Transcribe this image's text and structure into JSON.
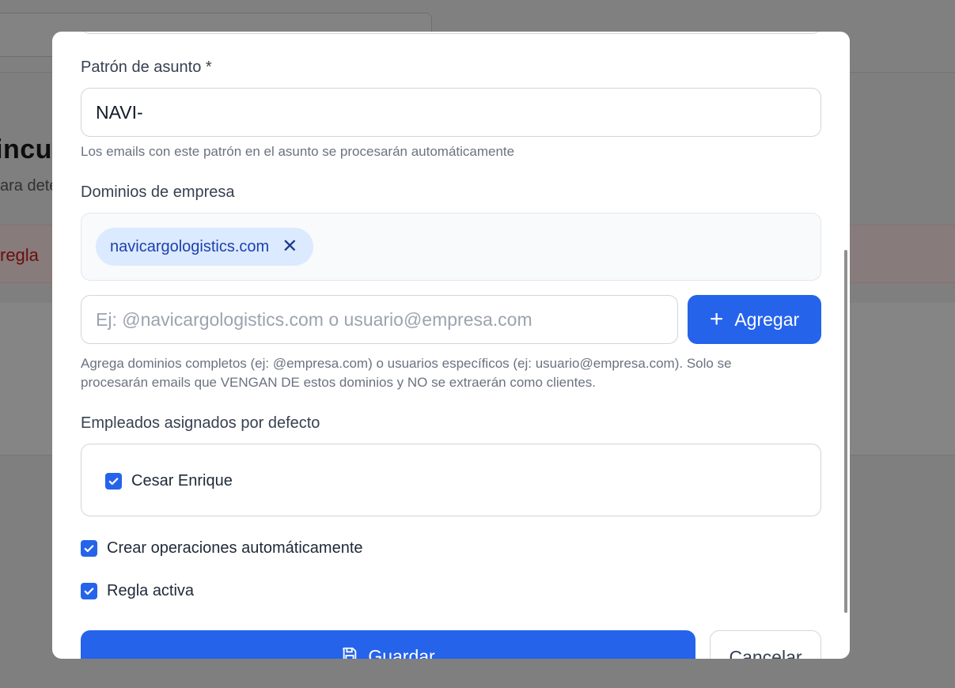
{
  "background": {
    "title_fragment": "incu",
    "subtitle_fragment": "ara dete",
    "alert_fragment": "regla"
  },
  "modal": {
    "subject_pattern": {
      "label": "Patrón de asunto *",
      "value": "NAVI-",
      "hint": "Los emails con este patrón en el asunto se procesarán automáticamente"
    },
    "domains": {
      "label": "Dominios de empresa",
      "chips": [
        "navicargologistics.com"
      ],
      "input_placeholder": "Ej: @navicargologistics.com o usuario@empresa.com",
      "add_label": "Agregar",
      "hint_line1": "Agrega dominios completos (ej: @empresa.com) o usuarios específicos (ej: usuario@empresa.com). Solo se",
      "hint_line2": "procesarán emails que VENGAN DE estos dominios y NO se extraerán como clientes."
    },
    "employees": {
      "label": "Empleados asignados por defecto",
      "items": [
        {
          "name": "Cesar Enrique",
          "checked": true
        }
      ]
    },
    "options": {
      "auto_create": {
        "label": "Crear operaciones automáticamente",
        "checked": true
      },
      "active": {
        "label": "Regla activa",
        "checked": true
      }
    },
    "actions": {
      "save_label": "Guardar",
      "cancel_label": "Cancelar"
    }
  },
  "colors": {
    "primary": "#2563eb",
    "chip_bg": "#dbeafe",
    "chip_text": "#1e40af",
    "overlay": "#7f7f7f"
  },
  "icons": {
    "remove_chip": "close-icon",
    "add": "plus-icon",
    "save": "save-icon",
    "check": "check-icon"
  }
}
